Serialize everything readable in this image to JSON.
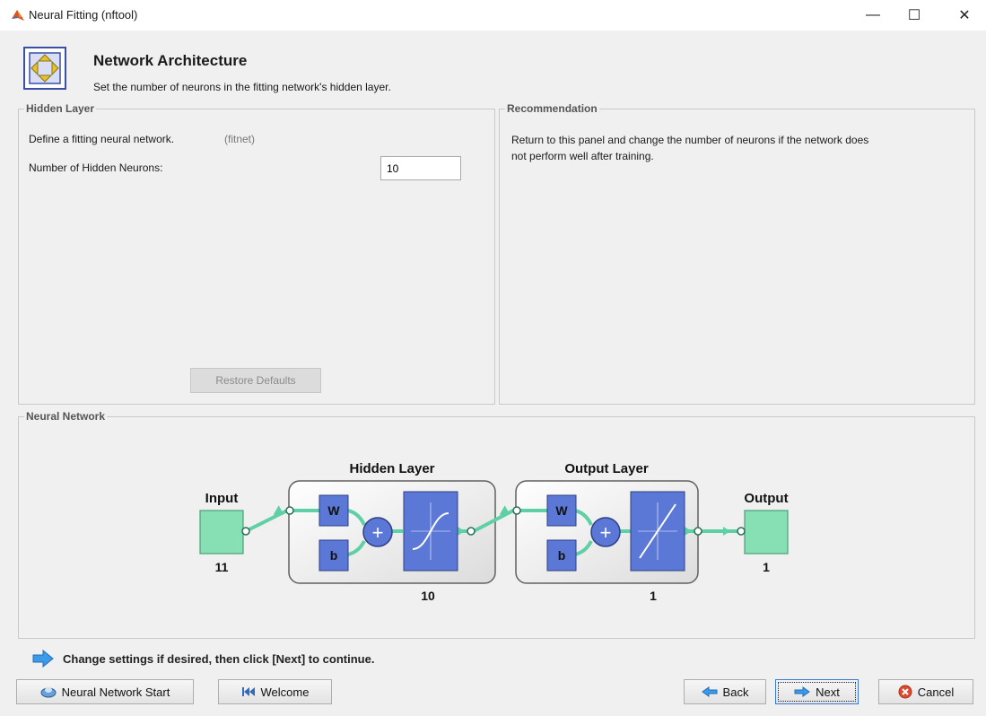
{
  "window": {
    "title": "Neural Fitting (nftool)",
    "minimize": "—",
    "maximize": "☐",
    "close": "✕"
  },
  "header": {
    "title": "Network Architecture",
    "subtitle": "Set the number of neurons in the fitting network's hidden layer."
  },
  "hidden_layer_panel": {
    "legend": "Hidden Layer",
    "define_text": "Define a fitting neural network.",
    "fitnet_note": "(fitnet)",
    "neurons_label": "Number of Hidden Neurons:",
    "neurons_value": "10",
    "restore_label": "Restore Defaults"
  },
  "recommendation_panel": {
    "legend": "Recommendation",
    "line1": "Return to this panel and change the number of neurons if the network does",
    "line2": "not perform well after training."
  },
  "network_panel": {
    "legend": "Neural Network",
    "input_label": "Input",
    "input_size": "11",
    "hidden_title": "Hidden Layer",
    "hidden_size": "10",
    "output_layer_title": "Output Layer",
    "output_layer_size": "1",
    "output_label": "Output",
    "output_size": "1",
    "weight_label": "W",
    "bias_label": "b",
    "plus_label": "+"
  },
  "hint": "Change settings  if desired, then click [Next] to continue.",
  "footer": {
    "nn_start_label": "Neural Network Start",
    "welcome_label": "Welcome",
    "back_label": "Back",
    "next_label": "Next",
    "cancel_label": "Cancel"
  },
  "colors": {
    "accent": "#5b78d6",
    "node_green": "#86e0b4",
    "arrow": "#5fd0a6",
    "panel_border": "#c9c9c9"
  }
}
